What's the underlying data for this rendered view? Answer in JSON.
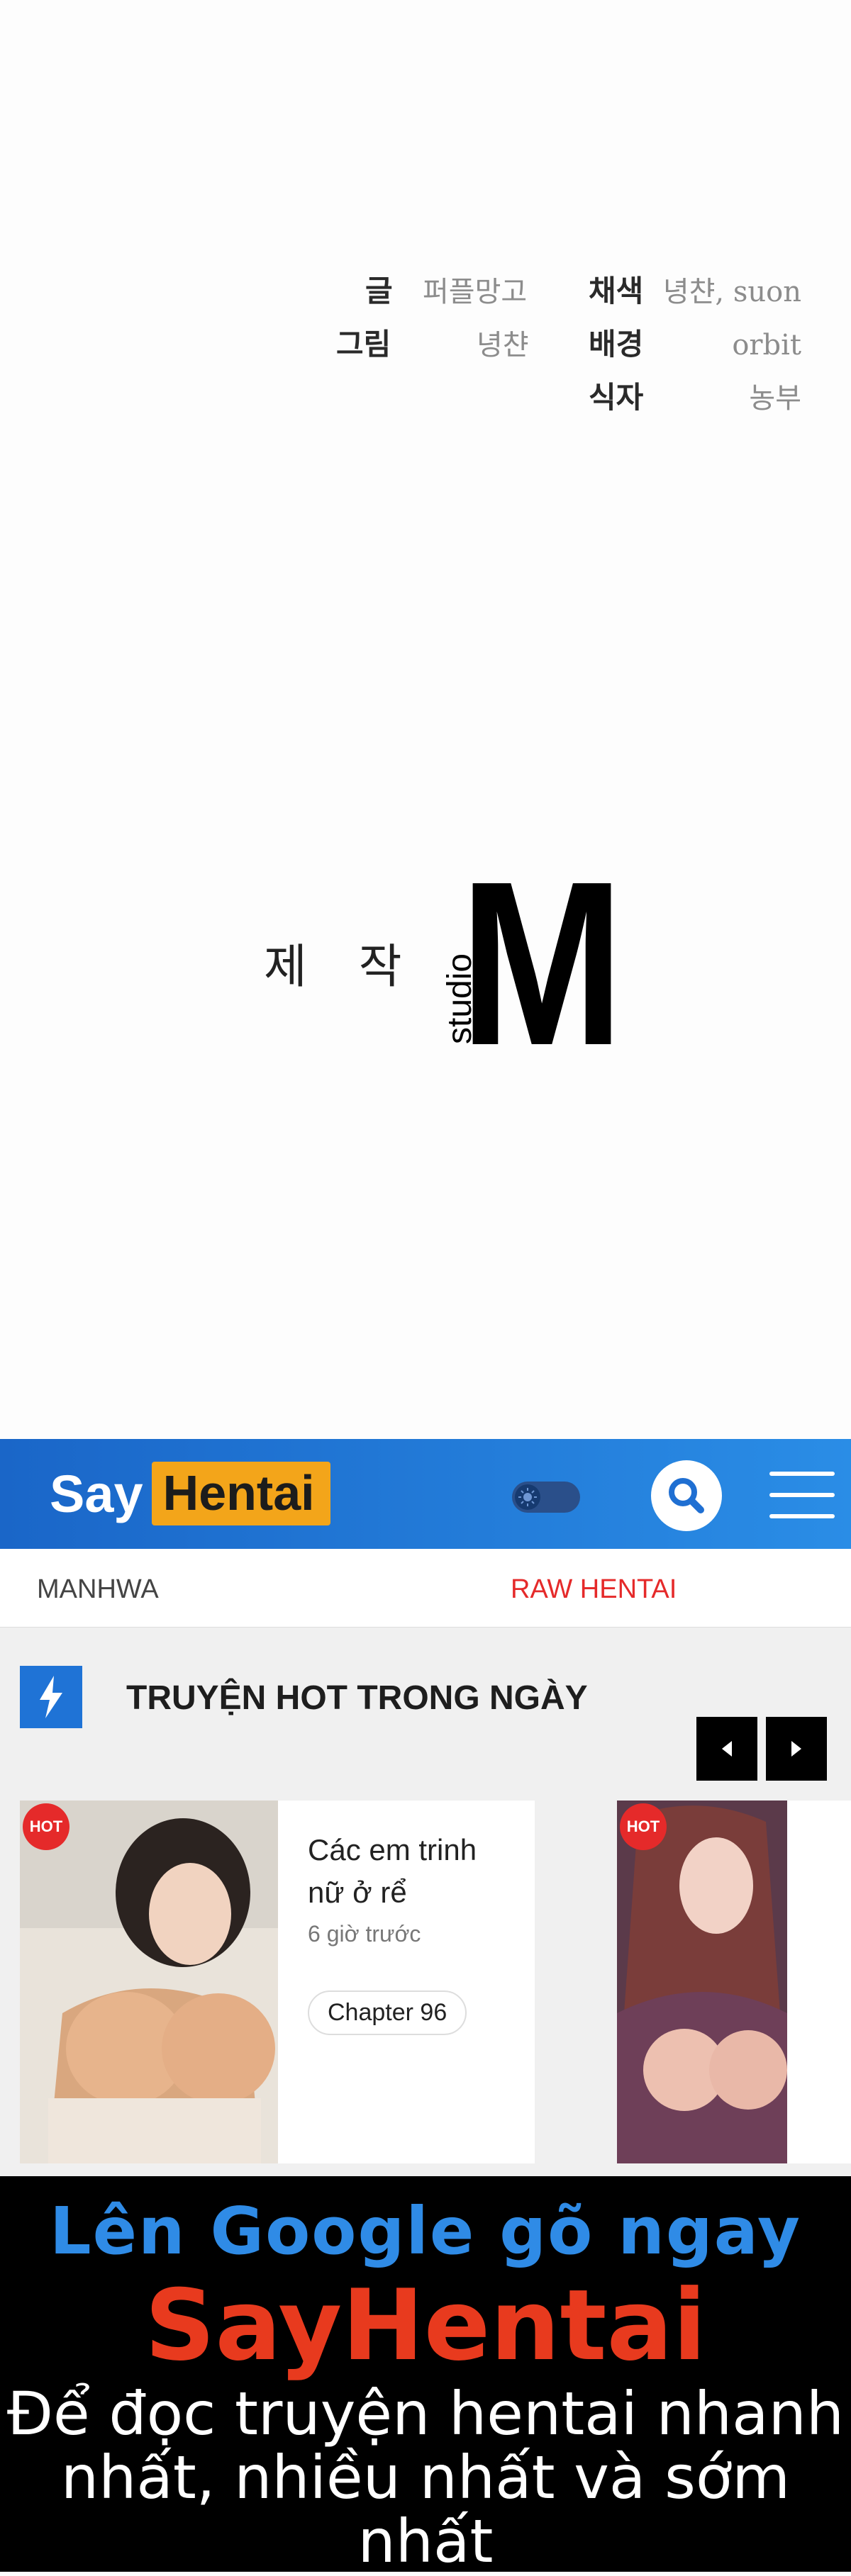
{
  "credits": {
    "story_label": "글",
    "story_value": "퍼플망고",
    "art_label": "그림",
    "art_value": "녕챤",
    "color_label": "채색",
    "color_value": "녕챤, suon",
    "bg_label": "배경",
    "bg_value": "orbit",
    "typeset_label": "식자",
    "typeset_value": "농부",
    "production_label": "제 작",
    "studio_logo_letter": "M",
    "studio_logo_word": "studio"
  },
  "site": {
    "brand_say": "Say",
    "brand_hentai": "Hentai",
    "nav": {
      "manhwa": "MANHWA",
      "raw": "RAW HENTAI"
    },
    "section_title": "TRUYỆN HOT TRONG NGÀY",
    "cards": [
      {
        "badge": "HOT",
        "title": "Các em trinh nữ ở rể",
        "time": "6 giờ trước",
        "chapter": "Chapter 96"
      },
      {
        "badge": "HOT"
      }
    ]
  },
  "promo": {
    "line1": "Lên Google gõ ngay",
    "line2": "SayHentai",
    "line3": "Để đọc truyện hentai nhanh nhất, nhiều nhất và sớm nhất"
  },
  "colors": {
    "header_blue": "#1a66c8",
    "brand_orange": "#f3a51a",
    "raw_red": "#e52a2a",
    "promo_blue": "#2f8be6",
    "promo_red": "#e83a1e"
  }
}
